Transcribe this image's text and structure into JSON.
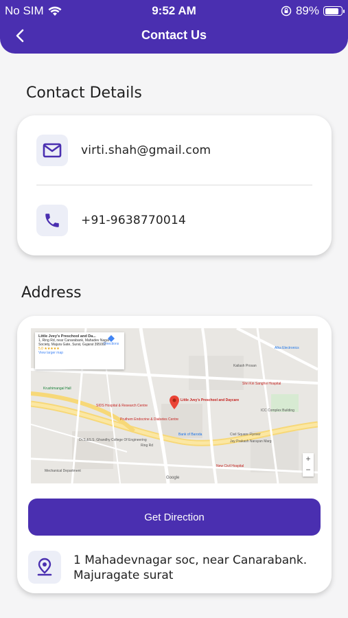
{
  "status_bar": {
    "carrier": "No SIM",
    "time": "9:52 AM",
    "battery": "89%",
    "battery_level": 0.89
  },
  "header": {
    "title": "Contact Us"
  },
  "contact": {
    "title": "Contact Details",
    "email": "virti.shah@gmail.com",
    "phone": "+91-9638770014"
  },
  "address": {
    "title": "Address",
    "button_label": "Get Direction",
    "text": "1 Mahadevnagar soc, near Canarabank. Majuragate surat",
    "map": {
      "place_name": "Little Jvey's Preschool and Da...",
      "place_address": "1, Ring Rd, near Canarabank, Mahadev Nagar Society, Majura Gate, Surat, Gujarat 395002",
      "rating": "5.0 ★★★★★",
      "view_larger": "View larger map",
      "directions": "Directions",
      "pin_label": "Little Jvey's Preschool and Daycare",
      "labels": {
        "l1": "Krushimangal Hall",
        "l2": "SIDS Hospital & Research Centre",
        "l3": "Pruthem Endocrine & Diabetes Centre",
        "l4": "Dr.S.&S.S. Ghandhy College Of Engineering",
        "l5": "Bank of Baroda",
        "l6": "Civil Square Flyover",
        "l7": "Jay Prakash Narayan Marg",
        "l8": "New Civil Hospital",
        "l9": "Shri Kiri Sanghvi Hospital",
        "l10": "Alka Electronics",
        "l11": "Kailash Prosan",
        "l12": "Ring Rd",
        "l13": "ICC Complex Building",
        "l14": "Mechanical Department",
        "l15": "Google"
      },
      "zoom_in": "+",
      "zoom_out": "−"
    }
  },
  "colors": {
    "primary": "#4a2fb0",
    "icon_bg": "#eceef7",
    "page_bg": "#f5f5f6"
  }
}
